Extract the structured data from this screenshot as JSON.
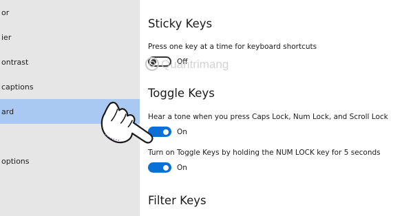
{
  "sidebar": {
    "items": [
      {
        "label": "or"
      },
      {
        "label": "ier"
      },
      {
        "label": "ontrast"
      },
      {
        "label": "captions"
      },
      {
        "label": "ard"
      },
      {
        "label": ""
      },
      {
        "label": "options"
      }
    ],
    "active_index": 4
  },
  "sticky_keys": {
    "title": "Sticky Keys",
    "description": "Press one key at a time for keyboard shortcuts",
    "toggle_state": "Off"
  },
  "toggle_keys": {
    "title": "Toggle Keys",
    "tone_description": "Hear a tone when you press Caps Lock, Num Lock, and Scroll Lock",
    "tone_state": "On",
    "numlock_description": "Turn on Toggle Keys by holding the NUM LOCK key for 5 seconds",
    "numlock_state": "On"
  },
  "filter_keys": {
    "title": "Filter Keys"
  },
  "watermark": {
    "text": "Quantrimang"
  },
  "colors": {
    "sidebar_bg": "#e6e6e6",
    "active_item": "#a9c9f2",
    "toggle_on": "#0a6fd6",
    "text": "#1a1a1a"
  },
  "icons": {
    "pointer": "hand-pointer-icon"
  }
}
